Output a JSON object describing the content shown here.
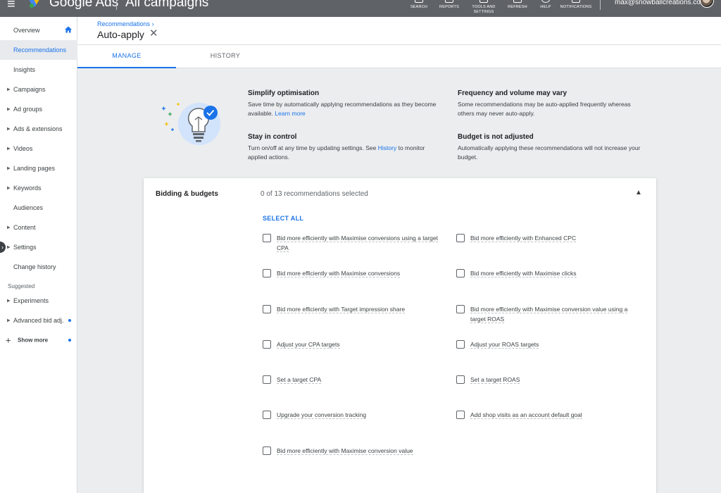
{
  "topbar": {
    "brand": "Google Ads",
    "scope": "All campaigns",
    "tools": [
      {
        "label": "SEARCH"
      },
      {
        "label": "REPORTS"
      },
      {
        "label": "TOOLS AND SETTINGS"
      },
      {
        "label": "REFRESH"
      },
      {
        "label": "HELP"
      },
      {
        "label": "NOTIFICATIONS"
      }
    ],
    "user_email": "max@snowballcreations.com"
  },
  "sidebar": {
    "items": [
      {
        "label": "Overview"
      },
      {
        "label": "Recommendations"
      },
      {
        "label": "Insights"
      },
      {
        "label": "Campaigns"
      },
      {
        "label": "Ad groups"
      },
      {
        "label": "Ads & extensions"
      },
      {
        "label": "Videos"
      },
      {
        "label": "Landing pages"
      },
      {
        "label": "Keywords"
      },
      {
        "label": "Audiences"
      },
      {
        "label": "Content"
      },
      {
        "label": "Settings"
      },
      {
        "label": "Change history"
      }
    ],
    "suggested_heading": "Suggested",
    "suggested": [
      {
        "label": "Experiments"
      },
      {
        "label": "Advanced bid adj."
      }
    ],
    "show_more": "Show more"
  },
  "header": {
    "breadcrumb": "Recommendations",
    "title": "Auto-apply"
  },
  "tabs": [
    {
      "label": "MANAGE"
    },
    {
      "label": "HISTORY"
    }
  ],
  "intro": {
    "simplify_title": "Simplify optimisation",
    "simplify_text": "Save time by automatically applying recommendations as they become available.",
    "simplify_link": "Learn more",
    "control_title": "Stay in control",
    "control_text_before": "Turn on/off at any time by updating settings. See",
    "control_link": "History",
    "control_text_after": "to monitor applied actions.",
    "frequency_title": "Frequency and volume may vary",
    "frequency_text": "Some recommendations may be auto-applied frequently whereas others may never auto-apply.",
    "budget_title": "Budget is not adjusted",
    "budget_text": "Automatically applying these recommendations will not increase your budget."
  },
  "card": {
    "title": "Bidding & budgets",
    "count": "0 of 13 recommendations selected",
    "select_all": "SELECT ALL",
    "options": [
      "Bid more efficiently with Maximise conversions using a target CPA",
      "Bid more efficiently with Enhanced CPC",
      "Bid more efficiently with Maximise conversions",
      "Bid more efficiently with Maximise clicks",
      "Bid more efficiently with Target impression share",
      "Bid more efficiently with Maximise conversion value using a target ROAS",
      "Adjust your CPA targets",
      "Adjust your ROAS targets",
      "Set a target CPA",
      "Set a target ROAS",
      "Upgrade your conversion tracking",
      "Add shop visits as an account default goal",
      "Bid more efficiently with Maximise conversion value"
    ]
  },
  "colors": {
    "accent": "#1a73e8",
    "topbar": "#5f6368",
    "background": "#ebedef"
  }
}
